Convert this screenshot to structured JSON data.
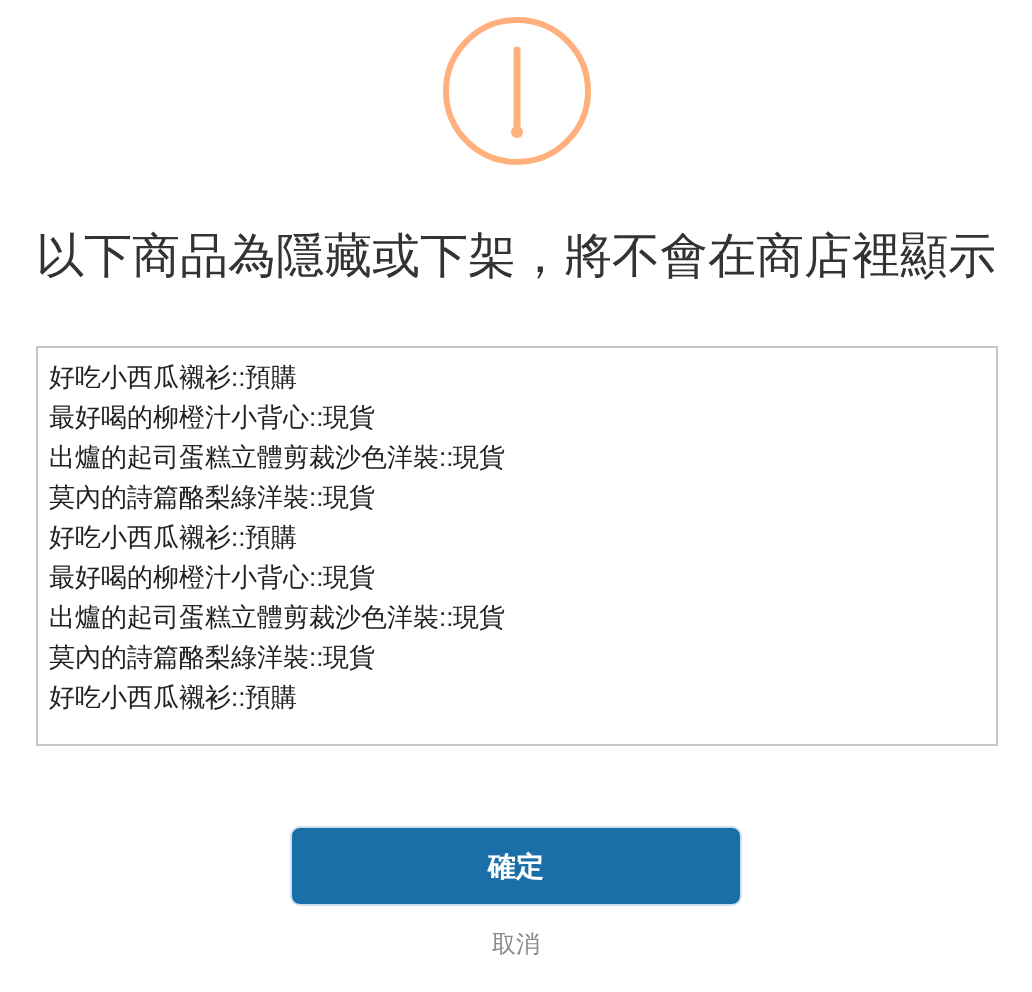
{
  "title": "以下商品為隱藏或下架，將不會在商店裡顯示",
  "items": [
    "好吃小西瓜襯衫::預購",
    "最好喝的柳橙汁小背心::現貨",
    "出爐的起司蛋糕立體剪裁沙色洋裝::現貨",
    "莫內的詩篇酪梨綠洋裝::現貨",
    "好吃小西瓜襯衫::預購",
    "最好喝的柳橙汁小背心::現貨",
    "出爐的起司蛋糕立體剪裁沙色洋裝::現貨",
    "莫內的詩篇酪梨綠洋裝::現貨",
    "好吃小西瓜襯衫::預購"
  ],
  "confirm_button": "確定",
  "cancel_link": "取消"
}
